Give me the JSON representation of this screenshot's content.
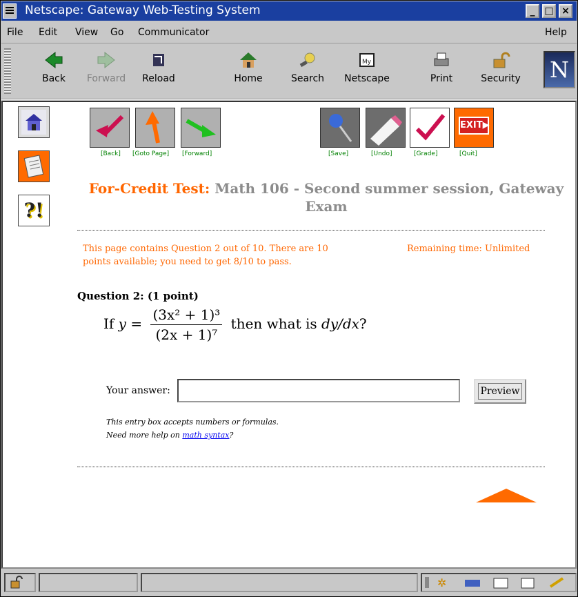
{
  "window": {
    "title": "Netscape: Gateway Web-Testing System"
  },
  "menubar": {
    "items": [
      "File",
      "Edit",
      "View",
      "Go",
      "Communicator"
    ],
    "help": "Help"
  },
  "toolbar": {
    "buttons": [
      {
        "label": "Back",
        "icon": "back-arrow-icon",
        "enabled": true
      },
      {
        "label": "Forward",
        "icon": "forward-arrow-icon",
        "enabled": false
      },
      {
        "label": "Reload",
        "icon": "reload-icon",
        "enabled": true
      },
      {
        "label": "Home",
        "icon": "home-icon",
        "enabled": true
      },
      {
        "label": "Search",
        "icon": "search-icon",
        "enabled": true
      },
      {
        "label": "Netscape",
        "icon": "netscape-icon",
        "enabled": true
      },
      {
        "label": "Print",
        "icon": "print-icon",
        "enabled": true
      },
      {
        "label": "Security",
        "icon": "padlock-icon",
        "enabled": true
      }
    ],
    "logo": "N"
  },
  "nav": {
    "labels": [
      "[Back]",
      "[Goto Page]",
      "[Forward]",
      "[Save]",
      "[Undo]",
      "[Grade]",
      "[Quit]"
    ],
    "exit_text": "EXIT"
  },
  "sidebar": {
    "icons": [
      "home-icon",
      "notes-icon",
      "help-icon"
    ],
    "help_glyph": "?!"
  },
  "page": {
    "heading_prefix": "For-Credit Test:",
    "heading_title": "Math 106 - Second summer session, Gateway Exam",
    "info_left": "This page contains Question 2 out of 10. There are 10 points available; you need to get 8/10 to pass.",
    "info_right": "Remaining time: Unlimited",
    "question_title": "Question 2: (1 point)",
    "question_text": {
      "lead": "If ",
      "var_y": "y",
      "eq": " = ",
      "numerator": "(3x² + 1)³",
      "denominator": "(2x + 1)⁷",
      "tail": " then what is ",
      "derivative": "dy/dx",
      "end": "?"
    },
    "answer_label": "Your answer:",
    "answer_value": "",
    "preview_label": "Preview",
    "help_line1": "This entry box accepts numbers or formulas.",
    "help_line2_prefix": "Need more help on ",
    "help_link": "math syntax",
    "help_line2_suffix": "?"
  },
  "colors": {
    "accent": "#ff6600",
    "gray_title": "#8c8c8c",
    "link": "#0000ee",
    "green_label": "#008000"
  }
}
